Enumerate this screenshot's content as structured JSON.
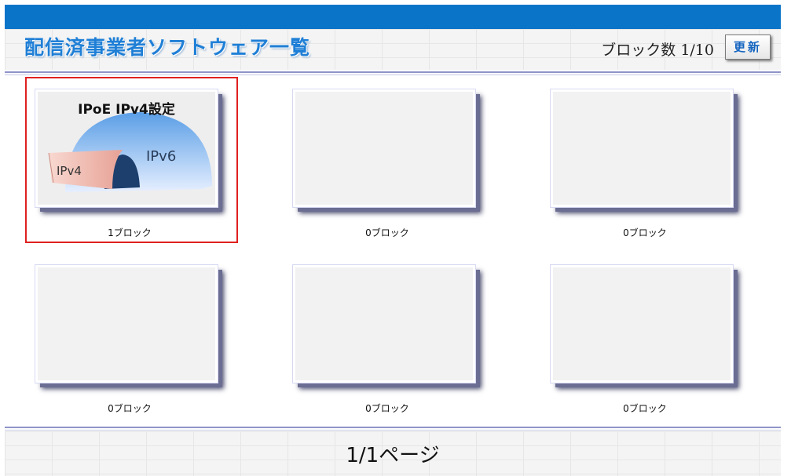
{
  "header": {
    "title": "配信済事業者ソフトウェア一覧",
    "block_count": "ブロック数 1/10",
    "refresh_label": "更新"
  },
  "tiles": [
    {
      "title": "IPoE IPv4設定",
      "ipv6_label": "IPv6",
      "ipv4_label": "IPv4",
      "caption": "1ブロック",
      "selected": true
    },
    {
      "caption": "0ブロック",
      "selected": false
    },
    {
      "caption": "0ブロック",
      "selected": false
    },
    {
      "caption": "0ブロック",
      "selected": false
    },
    {
      "caption": "0ブロック",
      "selected": false
    },
    {
      "caption": "0ブロック",
      "selected": false
    }
  ],
  "footer": {
    "page_indicator": "1/1ページ"
  },
  "colors": {
    "top_bar": "#0a74c9",
    "title": "#1f7fd6",
    "selection_border": "#e02020",
    "refresh_text": "#1565c0"
  }
}
